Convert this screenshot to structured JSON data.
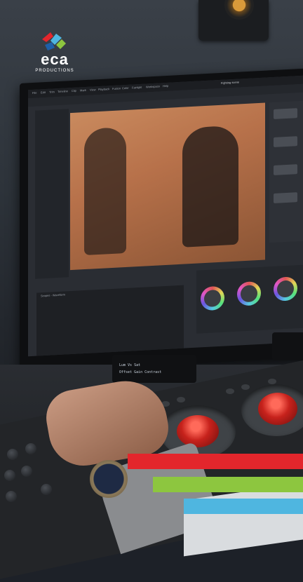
{
  "brand": {
    "name": "eca",
    "tagline": "PRODUCTIONS",
    "stripe_colors": [
      "#e3262c",
      "#8dc63f",
      "#4fb6e0"
    ]
  },
  "software": {
    "title": "Fighting scene",
    "menu": [
      "File",
      "Edit",
      "Trim",
      "Timeline",
      "Clip",
      "Mark",
      "View",
      "Playback",
      "Fusion",
      "Color",
      "Fairlight",
      "Workspace",
      "Help"
    ],
    "scope_title": "Scopes - Waveform"
  },
  "control_panel": {
    "lcd_line1": "Lum Vs Sat",
    "lcd_line2": "Offset  Gain  Contrast"
  },
  "icons": [
    "eca-logo-icon",
    "trackball-icon",
    "knob-icon",
    "watch-icon"
  ]
}
